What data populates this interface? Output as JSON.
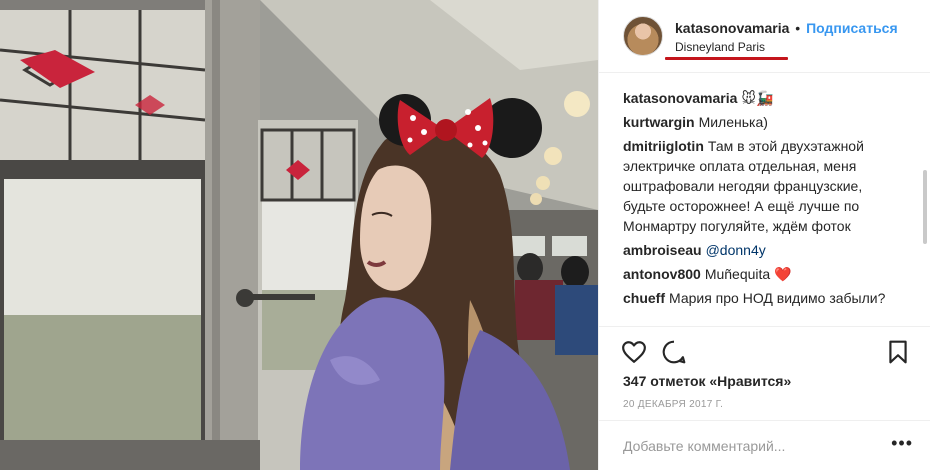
{
  "post": {
    "author": "katasonovamaria",
    "separator": "•",
    "follow_label": "Подписаться",
    "location": "Disneyland Paris"
  },
  "comments": [
    {
      "user": "katasonovamaria",
      "text": "🐭🚂"
    },
    {
      "user": "kurtwargin",
      "text": "Миленька)"
    },
    {
      "user": "dmitriiglotin",
      "text": "Там в этой двухэтажной электричке оплата отдельная, меня оштрафовали негодяи французские, будьте осторожнее! А ещё лучше по Монмартру погуляйте, ждём фоток"
    },
    {
      "user": "ambroiseau",
      "text": "@donn4y"
    },
    {
      "user": "antonov800",
      "text": "Muñequita",
      "emoji": "❤️"
    },
    {
      "user": "chueff",
      "text": "Мария про НОД видимо забыли?"
    }
  ],
  "actions": {
    "like_icon": "heart-outline-icon",
    "comment_icon": "speech-bubble-icon",
    "save_icon": "bookmark-icon",
    "likes_text": "347 отметок «Нравится»",
    "date": "20 ДЕКАБРЯ 2017 Г."
  },
  "add_comment": {
    "placeholder": "Добавьте комментарий...",
    "more_label": "•••"
  },
  "colors": {
    "link_blue": "#3897f0",
    "highlight_red": "#c4151c",
    "heart_red": "#ed1c24"
  }
}
